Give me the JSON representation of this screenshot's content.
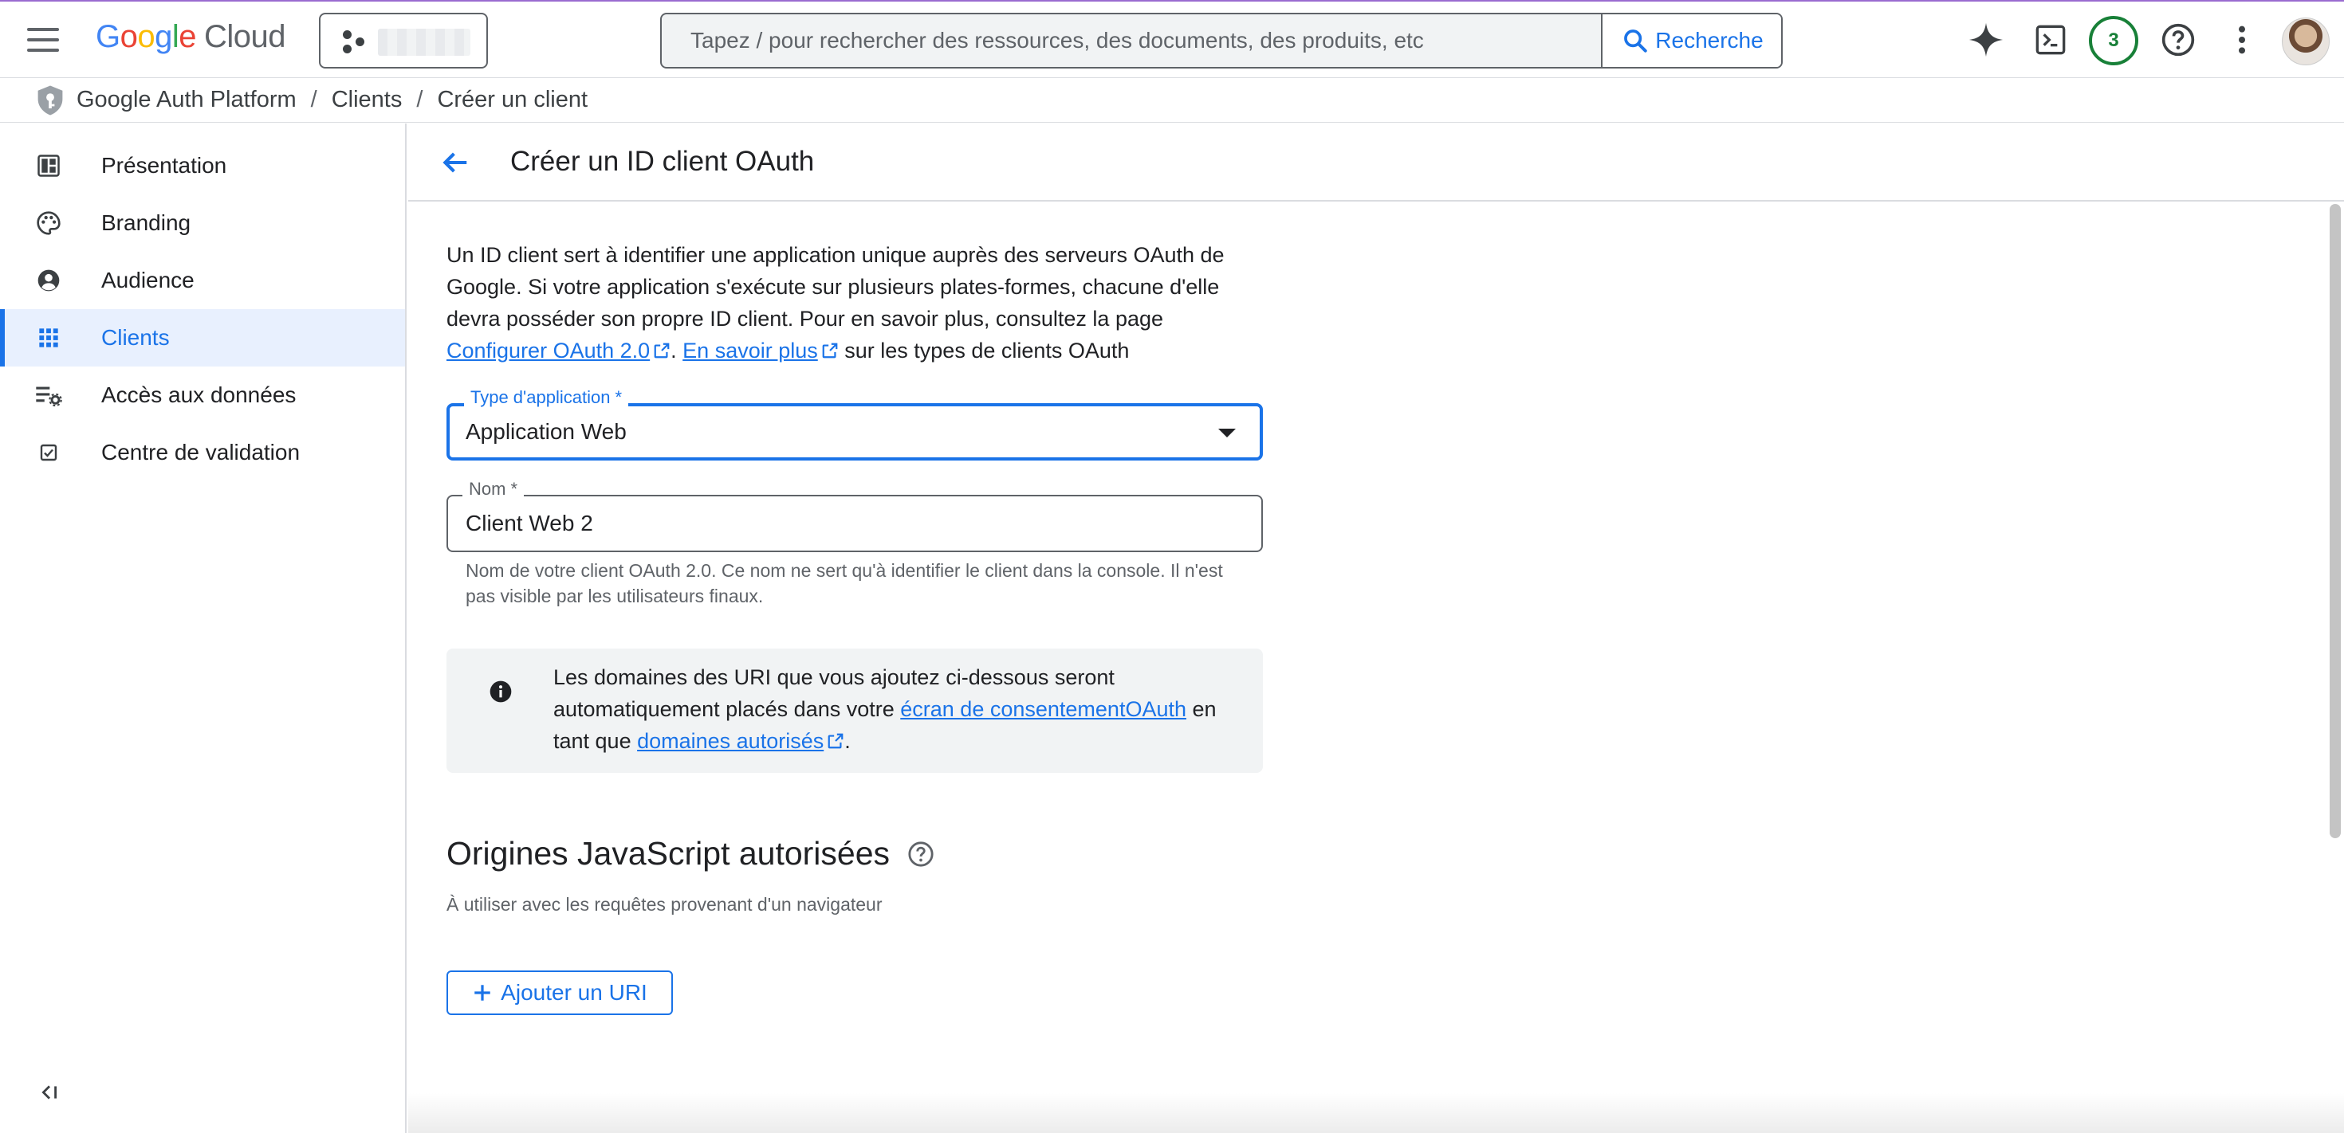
{
  "header": {
    "logo": {
      "google": "Google",
      "cloud": "Cloud"
    },
    "search": {
      "placeholder": "Tapez / pour rechercher des ressources, des documents, des produits, etc",
      "button_label": "Recherche"
    },
    "notifications_count": "3"
  },
  "breadcrumb": [
    "Google Auth Platform",
    "Clients",
    "Créer un client"
  ],
  "sidebar": {
    "items": [
      {
        "label": "Présentation",
        "icon": "dashboard-icon"
      },
      {
        "label": "Branding",
        "icon": "palette-icon"
      },
      {
        "label": "Audience",
        "icon": "account-circle-icon"
      },
      {
        "label": "Clients",
        "icon": "apps-grid-icon",
        "active": true
      },
      {
        "label": "Accès aux données",
        "icon": "data-settings-icon"
      },
      {
        "label": "Centre de validation",
        "icon": "checkbox-icon"
      }
    ]
  },
  "page": {
    "title": "Créer un ID client OAuth",
    "intro": {
      "text": "Un ID client sert à identifier une application unique auprès des serveurs OAuth de Google. Si votre application s'exécute sur plusieurs plates-formes, chacune d'elle devra posséder son propre ID client. Pour en savoir plus, consultez la page ",
      "link1": "Configurer OAuth 2.0",
      "sep": ". ",
      "link2": "En savoir plus",
      "suffix": " sur les types de clients OAuth"
    },
    "app_type": {
      "label": "Type d'application *",
      "value": "Application Web"
    },
    "name": {
      "label": "Nom *",
      "value": "Client Web 2",
      "helper": "Nom de votre client OAuth 2.0. Ce nom ne sert qu'à identifier le client dans la console. Il n'est pas visible par les utilisateurs finaux."
    },
    "info": {
      "text": "Les domaines des URI que vous ajoutez ci-dessous seront automatiquement placés dans votre ",
      "link1": "écran de consentementOAuth",
      "middle": " en tant que ",
      "link2": "domaines autorisés",
      "suffix": "."
    },
    "js_origins": {
      "title": "Origines JavaScript autorisées",
      "subtitle": "À utiliser avec les requêtes provenant d'un navigateur",
      "add_button": "Ajouter un URI"
    }
  },
  "colors": {
    "accent": "#1a73e8",
    "active_bg": "#e8f0fe",
    "badge": "#188038"
  }
}
